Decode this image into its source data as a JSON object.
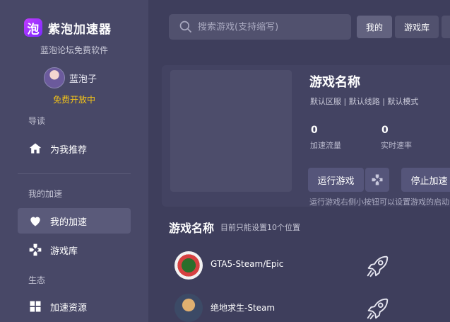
{
  "sidebar": {
    "logo_badge": "泡",
    "logo_text": "紫泡加速器",
    "subtitle": "蓝泡论坛免费软件",
    "username": "蓝泡子",
    "free_tag": "免费开放中",
    "sections": {
      "guide": "导读",
      "my_accel": "我的加速",
      "ecosystem": "生态"
    },
    "items": {
      "recommend": "为我推荐",
      "my_acceleration": "我的加速",
      "game_library": "游戏库",
      "resources": "加速资源"
    }
  },
  "topbar": {
    "search_placeholder": "搜索游戏(支持缩写)",
    "tabs": [
      "我的",
      "游戏库"
    ]
  },
  "game_card": {
    "title": "游戏名称",
    "meta": "默认区服 | 默认线路 | 默认模式",
    "traffic_value": "0",
    "traffic_label": "加速流量",
    "speed_value": "0",
    "speed_label": "实时速率",
    "run_button": "运行游戏",
    "stop_button": "停止加速",
    "hint": "运行游戏右侧小按钮可以设置游戏的启动"
  },
  "list": {
    "title": "游戏名称",
    "subtitle": "目前只能设置10个位置",
    "rows": [
      {
        "name": "GTA5-Steam/Epic",
        "icon": "gta5-icon"
      },
      {
        "name": "绝地求生-Steam",
        "icon": "pubg-icon"
      }
    ]
  },
  "colors": {
    "background": "#3e3e5c",
    "sidebar": "#484867",
    "accent_purple": "#a93bff",
    "free_tag": "#f5c518"
  }
}
